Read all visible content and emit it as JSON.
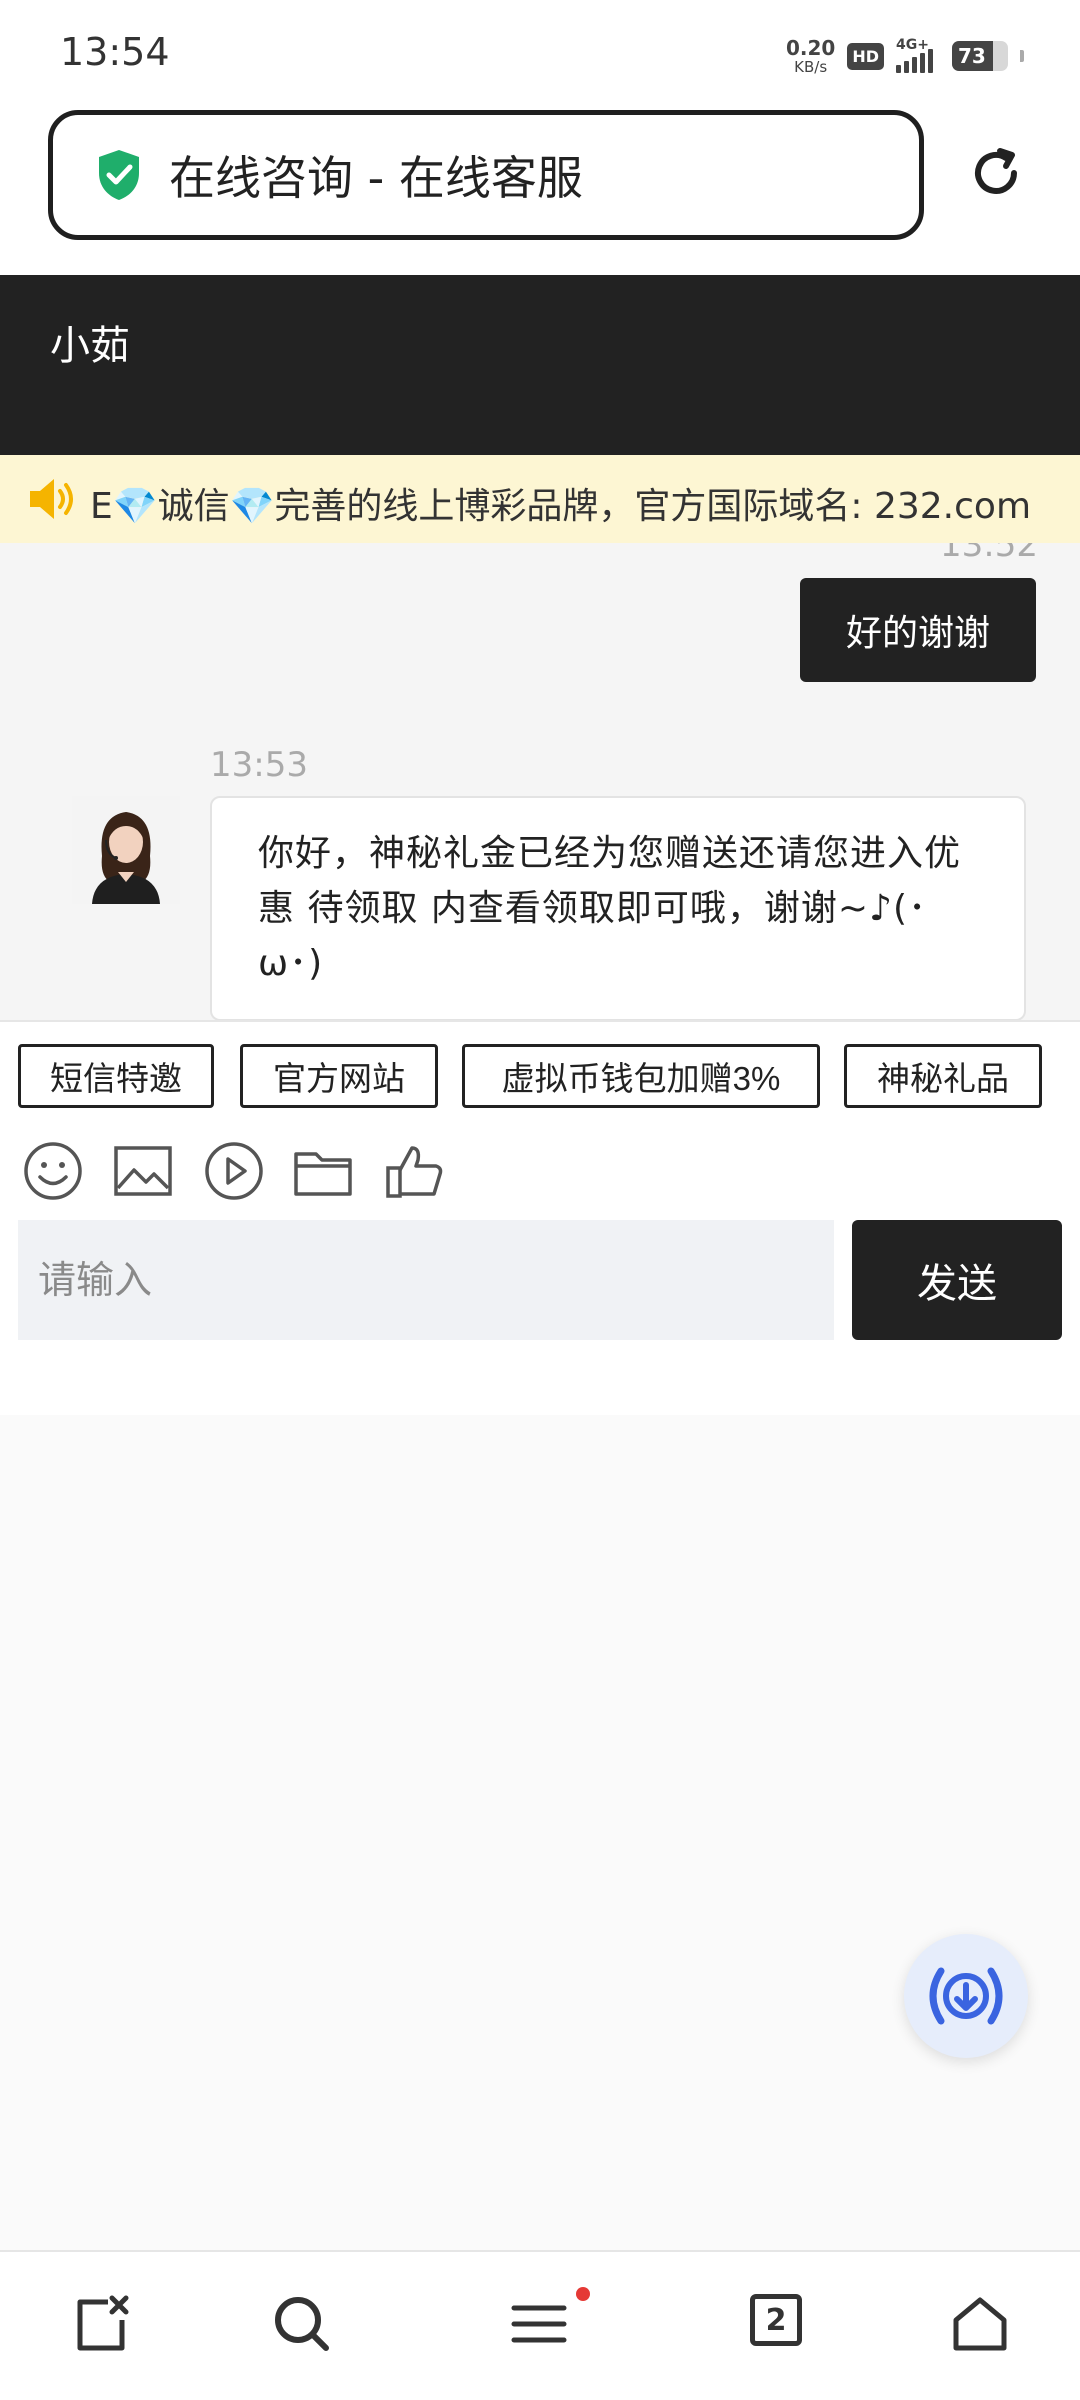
{
  "status_bar": {
    "time": "13:54",
    "net_speed": "0.20",
    "net_unit": "KB/s",
    "hd": "HD",
    "network": "4G+",
    "battery": "73"
  },
  "browser": {
    "page_title": "在线咨询 - 在线客服",
    "secure_icon": "shield-check-icon",
    "reload_icon": "reload-icon"
  },
  "chat": {
    "agent_name": "小茹",
    "announcement": "E💎诚信💎完善的线上博彩品牌，官方国际域名: 232.com",
    "messages": [
      {
        "side": "out",
        "time": "13:52",
        "text": "好的谢谢"
      },
      {
        "side": "in",
        "time": "13:53",
        "text": "你好，神秘礼金已经为您赠送还请您进入优惠 待领取 内查看领取即可哦，谢谢~♪(･ω･)"
      }
    ],
    "quick_replies": [
      "短信特邀",
      "官方网站",
      "虚拟币钱包加赠3%",
      "神秘礼品"
    ],
    "tools": [
      "emoji-icon",
      "image-icon",
      "video-icon",
      "folder-icon",
      "thumbs-up-icon"
    ],
    "input_placeholder": "请输入",
    "send_label": "发送"
  },
  "bottom_nav": {
    "tab_count": "2",
    "items": [
      "close-tab-icon",
      "search-icon",
      "menu-icon",
      "tabs-icon",
      "home-icon"
    ]
  },
  "colors": {
    "header_bg": "#222222",
    "announcement_bg": "#fdf6d3",
    "accent_blue": "#3a64e0",
    "secure_green": "#1fae6b",
    "notification_red": "#e53935"
  }
}
